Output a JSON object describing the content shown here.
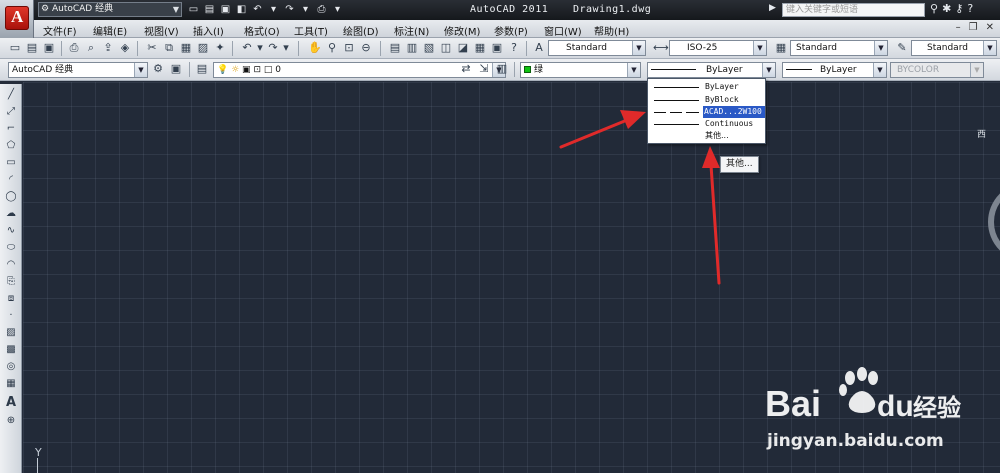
{
  "titlebar": {
    "workspace": "AutoCAD 经典",
    "app_title": "AutoCAD 2011",
    "doc_title": "Drawing1.dwg",
    "search_placeholder": "键入关键字或短语"
  },
  "menu": [
    "文件(F)",
    "编辑(E)",
    "视图(V)",
    "插入(I)",
    "格式(O)",
    "工具(T)",
    "绘图(D)",
    "标注(N)",
    "修改(M)",
    "参数(P)",
    "窗口(W)",
    "帮助(H)"
  ],
  "styles": {
    "text_style": "Standard",
    "dim_style": "ISO-25",
    "table_style": "Standard",
    "mleader_style": "Standard"
  },
  "properties": {
    "workspace": "AutoCAD 经典",
    "layer": "0",
    "color_label": "绿",
    "color_hex": "#10c312",
    "linetype": "ByLayer",
    "lineweight": "ByLayer",
    "plot_style": "BYCOLOR"
  },
  "linetype_list": {
    "items": [
      "ByLayer",
      "ByBlock",
      "ACAD...2W100",
      "Continuous",
      "其他..."
    ],
    "selected_index": 2
  },
  "tooltip": "其他...",
  "drawing": {
    "ucs_label": "Y",
    "viewcube_label": "西"
  },
  "watermark": {
    "brand": "Bai",
    "brand2": "du",
    "brand_cn": "经验",
    "url": "jingyan.baidu.com"
  },
  "colors": {
    "drawing_bg": "#222a38",
    "annotation_red": "#e02a2a",
    "selection_blue": "#2a59c6"
  }
}
